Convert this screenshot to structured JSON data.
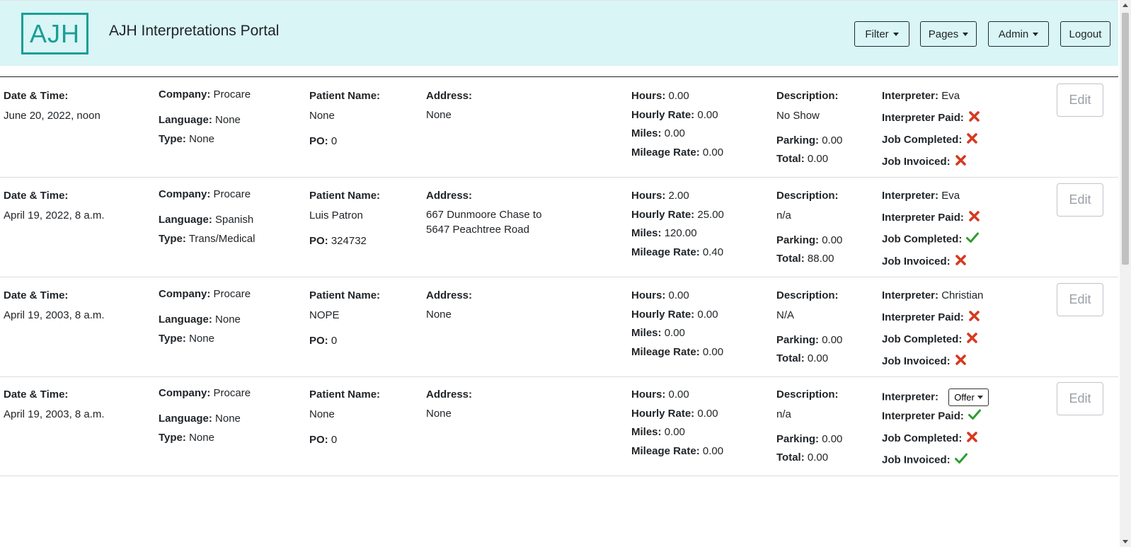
{
  "header": {
    "logo_text": "AJH",
    "title": "AJH Interpretations Portal",
    "nav": {
      "filter": "Filter",
      "pages": "Pages",
      "admin": "Admin",
      "logout": "Logout"
    }
  },
  "labels": {
    "datetime": "Date & Time:",
    "company": "Company:",
    "language": "Language:",
    "type": "Type:",
    "patient": "Patient Name:",
    "po": "PO:",
    "address": "Address:",
    "hours": "Hours:",
    "hourly_rate": "Hourly Rate:",
    "miles": "Miles:",
    "mileage_rate": "Mileage Rate:",
    "description": "Description:",
    "parking": "Parking:",
    "total": "Total:",
    "interpreter": "Interpreter:",
    "interpreter_paid": "Interpreter Paid:",
    "job_completed": "Job Completed:",
    "job_invoiced": "Job Invoiced:",
    "edit": "Edit"
  },
  "status_colors": {
    "yes": "#2e9d2e",
    "no": "#d63a1f"
  },
  "jobs": [
    {
      "datetime": "June 20, 2022, noon",
      "company": "Procare",
      "language": "None",
      "type": "None",
      "patient": "None",
      "po": "0",
      "address": "None",
      "hours": "0.00",
      "hourly_rate": "0.00",
      "miles": "0.00",
      "mileage_rate": "0.00",
      "description": "No Show",
      "parking": "0.00",
      "total": "0.00",
      "interpreter": "Eva",
      "interpreter_is_offer": false,
      "interpreter_paid": false,
      "job_completed": false,
      "job_invoiced": false
    },
    {
      "datetime": "April 19, 2022, 8 a.m.",
      "company": "Procare",
      "language": "Spanish",
      "type": "Trans/Medical",
      "patient": "Luis Patron",
      "po": "324732",
      "address": "667 Dunmoore Chase to 5647 Peachtree Road",
      "hours": "2.00",
      "hourly_rate": "25.00",
      "miles": "120.00",
      "mileage_rate": "0.40",
      "description": "n/a",
      "parking": "0.00",
      "total": "88.00",
      "interpreter": "Eva",
      "interpreter_is_offer": false,
      "interpreter_paid": false,
      "job_completed": true,
      "job_invoiced": false
    },
    {
      "datetime": "April 19, 2003, 8 a.m.",
      "company": "Procare",
      "language": "None",
      "type": "None",
      "patient": "NOPE",
      "po": "0",
      "address": "None",
      "hours": "0.00",
      "hourly_rate": "0.00",
      "miles": "0.00",
      "mileage_rate": "0.00",
      "description": "N/A",
      "parking": "0.00",
      "total": "0.00",
      "interpreter": "Christian",
      "interpreter_is_offer": false,
      "interpreter_paid": false,
      "job_completed": false,
      "job_invoiced": false
    },
    {
      "datetime": "April 19, 2003, 8 a.m.",
      "company": "Procare",
      "language": "None",
      "type": "None",
      "patient": "None",
      "po": "0",
      "address": "None",
      "hours": "0.00",
      "hourly_rate": "0.00",
      "miles": "0.00",
      "mileage_rate": "0.00",
      "description": "n/a",
      "parking": "0.00",
      "total": "0.00",
      "interpreter": "Offer",
      "interpreter_is_offer": true,
      "interpreter_paid": true,
      "job_completed": false,
      "job_invoiced": true
    }
  ]
}
